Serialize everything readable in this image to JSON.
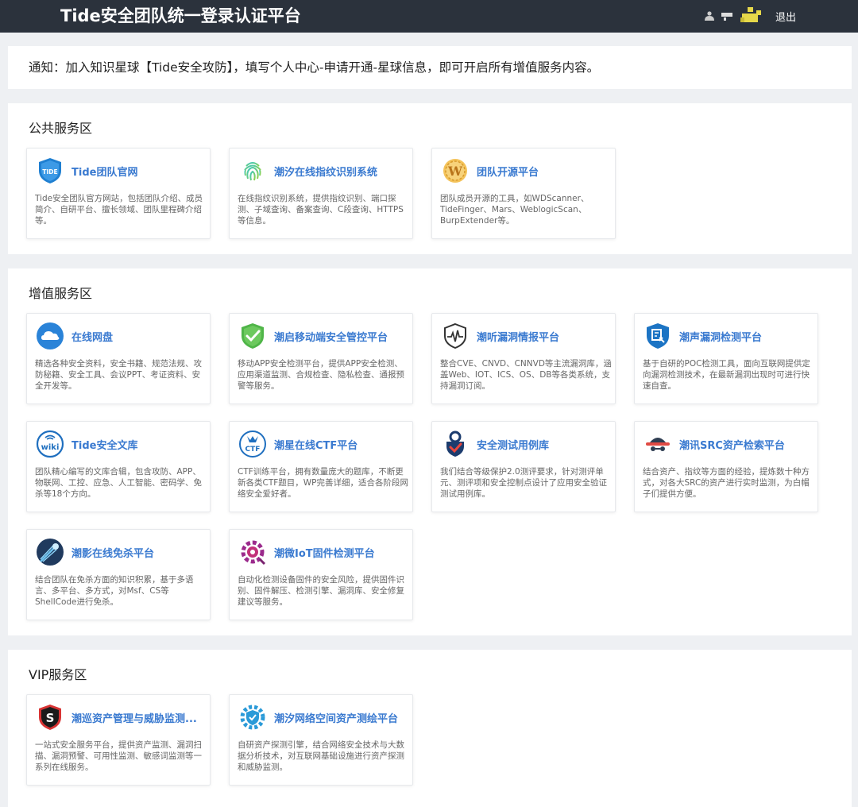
{
  "header": {
    "title": "Tide安全团队统一登录认证平台",
    "logout_label": "退出"
  },
  "notice": {
    "text": "通知：加入知识星球【Tide安全攻防】，填写个人中心-申请开通-星球信息，即可开启所有增值服务内容。"
  },
  "public": {
    "title": "公共服务区",
    "cards": [
      {
        "title": "Tide团队官网",
        "desc": "Tide安全团队官方网站，包括团队介绍、成员简介、自研平台、擅长领域、团队里程碑介绍等。",
        "icon": "tide-shield-icon"
      },
      {
        "title": "潮汐在线指纹识别系统",
        "desc": "在线指纹识别系统，提供指纹识别、端口探测、子域查询、备案查询、C段查询、HTTPS等信息。",
        "icon": "fingerprint-icon"
      },
      {
        "title": "团队开源平台",
        "desc": "团队成员开源的工具，如WDScanner、TideFinger、Mars、WeblogicScan、BurpExtender等。",
        "icon": "w-badge-icon"
      }
    ]
  },
  "value": {
    "title": "增值服务区",
    "cards": [
      {
        "title": "在线网盘",
        "desc": "精选各种安全资料，安全书籍、规范法规、攻防秘籍、安全工具、会议PPT、考证资料、安全开发等。",
        "icon": "cloud-icon"
      },
      {
        "title": "潮启移动端安全管控平台",
        "desc": "移动APP安全检测平台，提供APP安全检测、应用渠道监测、合规检查、隐私检查、通报预警等服务。",
        "icon": "shield-check-icon"
      },
      {
        "title": "潮听漏洞情报平台",
        "desc": "整合CVE、CNVD、CNNVD等主流漏洞库，涵盖Web、IOT、ICS、OS、DB等各类系统，支持漏洞订阅。",
        "icon": "pulse-shield-icon"
      },
      {
        "title": "潮声漏洞检测平台",
        "desc": "基于自研的POC检测工具，面向互联网提供定向漏洞检测技术，在最新漏洞出现时可进行快速自查。",
        "icon": "scan-shield-icon"
      },
      {
        "title": "Tide安全文库",
        "desc": "团队精心编写的文库合辑，包含攻防、APP、物联网、工控、应急、人工智能、密码学、免杀等18个方向。",
        "icon": "wiki-icon"
      },
      {
        "title": "潮星在线CTF平台",
        "desc": "CTF训练平台，拥有数量庞大的题库，不断更新各类CTF题目，WP完善详细，适合各阶段网络安全爱好者。",
        "icon": "ctf-icon"
      },
      {
        "title": "安全测试用例库",
        "desc": "我们结合等级保护2.0测评要求，针对测评单元、测评项和安全控制点设计了应用安全验证测试用例库。",
        "icon": "test-shield-icon"
      },
      {
        "title": "潮讯SRC资产检索平台",
        "desc": "结合资产、指纹等方面的经验，提炼数十种方式，对各大SRC的资产进行实时监测，为白帽子们提供方便。",
        "icon": "hat-icon"
      },
      {
        "title": "潮影在线免杀平台",
        "desc": "结合团队在免杀方面的知识积累，基于多语言、多平台、多方式，对Msf、CS等ShellCode进行免杀。",
        "icon": "comet-icon"
      },
      {
        "title": "潮微IoT固件检测平台",
        "desc": "自动化检测设备固件的安全风险，提供固件识别、固件解压、检测引擎、漏洞库、安全修复建议等服务。",
        "icon": "gear-bug-icon"
      }
    ]
  },
  "vip": {
    "title": "VIP服务区",
    "cards": [
      {
        "title": "潮巡资产管理与威胁监测...",
        "desc": "一站式安全服务平台，提供资产监测、漏洞扫描、漏洞预警、可用性监测、敏感词监测等一系列在线服务。",
        "icon": "s-shield-icon"
      },
      {
        "title": "潮汐网络空间资产测绘平台",
        "desc": "自研资产探测引擎，结合网络安全技术与大数据分析技术，对互联网基础设施进行资产探测和威胁监测。",
        "icon": "gear-shield-icon"
      }
    ]
  }
}
